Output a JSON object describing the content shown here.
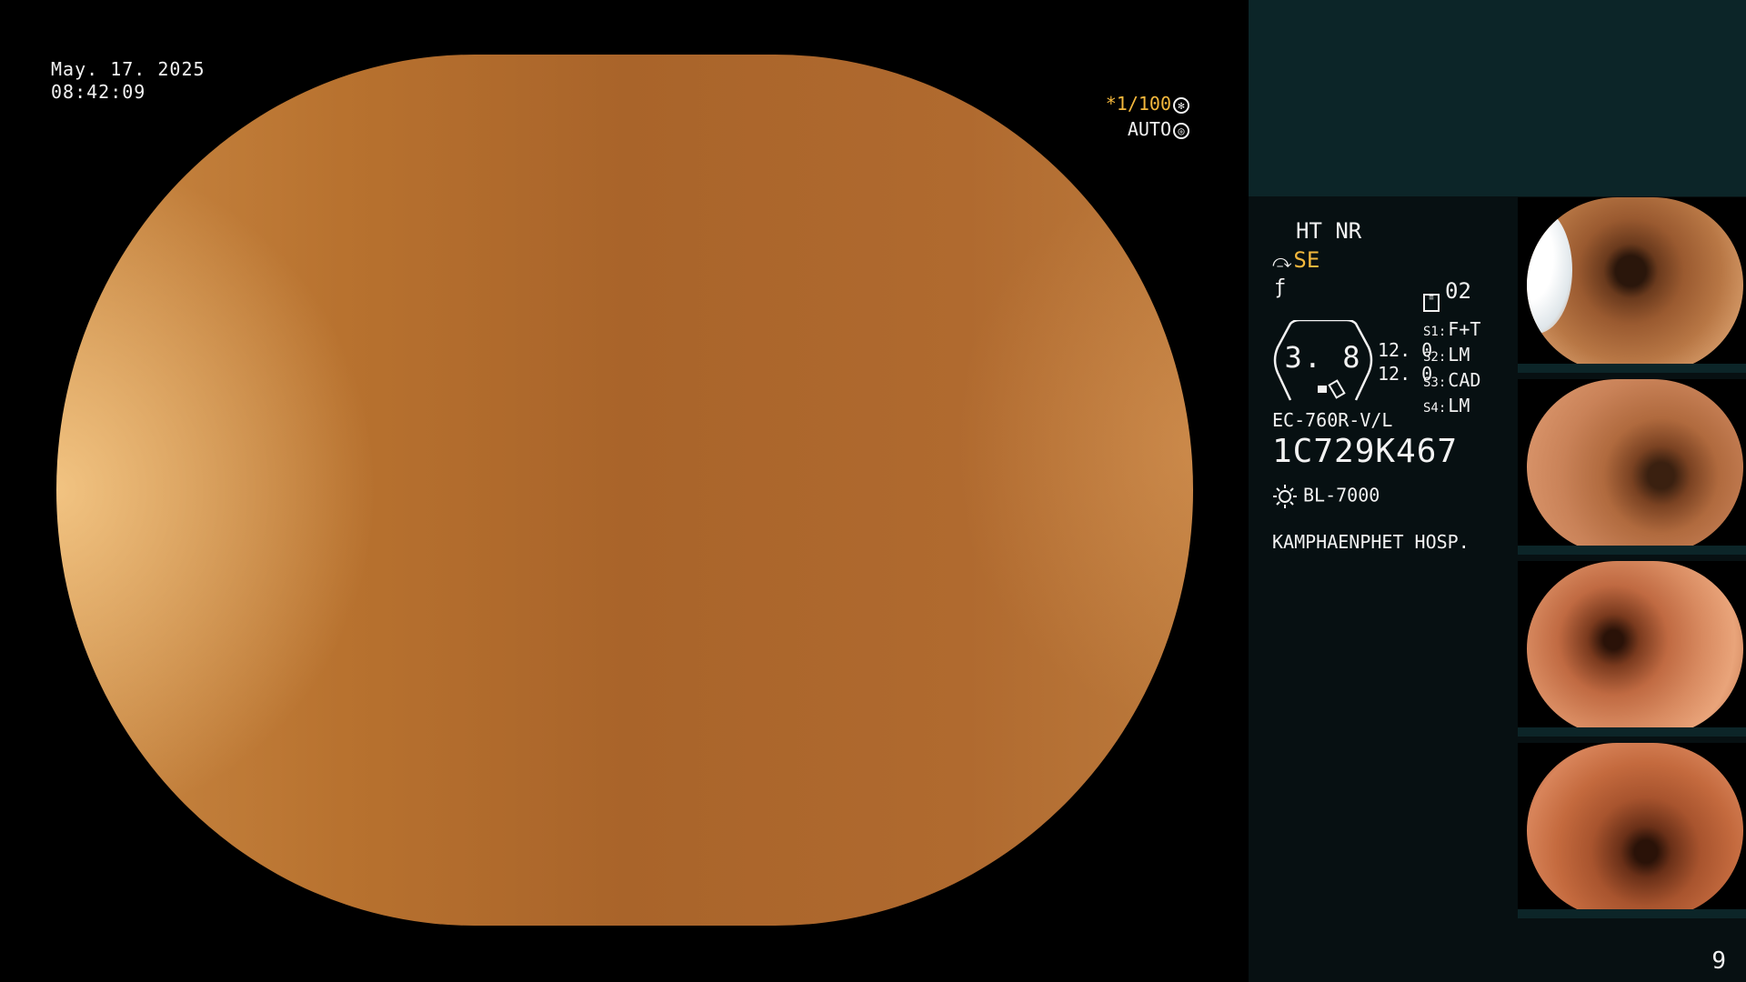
{
  "overlay": {
    "date": "May. 17. 2025",
    "time": "08:42:09",
    "shutter": "*1/100",
    "auto": "AUTO"
  },
  "panel": {
    "mode": "HT NR",
    "enhancement": "SE",
    "slot": "02",
    "gauge_value": "3. 8",
    "values": [
      "12. 0",
      "12. 0"
    ],
    "settings": [
      {
        "key": "S1:",
        "value": "F+T"
      },
      {
        "key": "S2:",
        "value": "LM"
      },
      {
        "key": "S3:",
        "value": "CAD"
      },
      {
        "key": "S4:",
        "value": "LM"
      }
    ],
    "scope_model": "EC-760R-V/L",
    "serial": "1C729K467",
    "light_source": "BL-7000",
    "hospital": "KAMPHAENPHET HOSP."
  },
  "page_counter": "9",
  "colors": {
    "accent": "#f3b73c",
    "panel_top": "#0c2528",
    "panel_bg": "#071012",
    "tissue": "#b06a2f"
  }
}
